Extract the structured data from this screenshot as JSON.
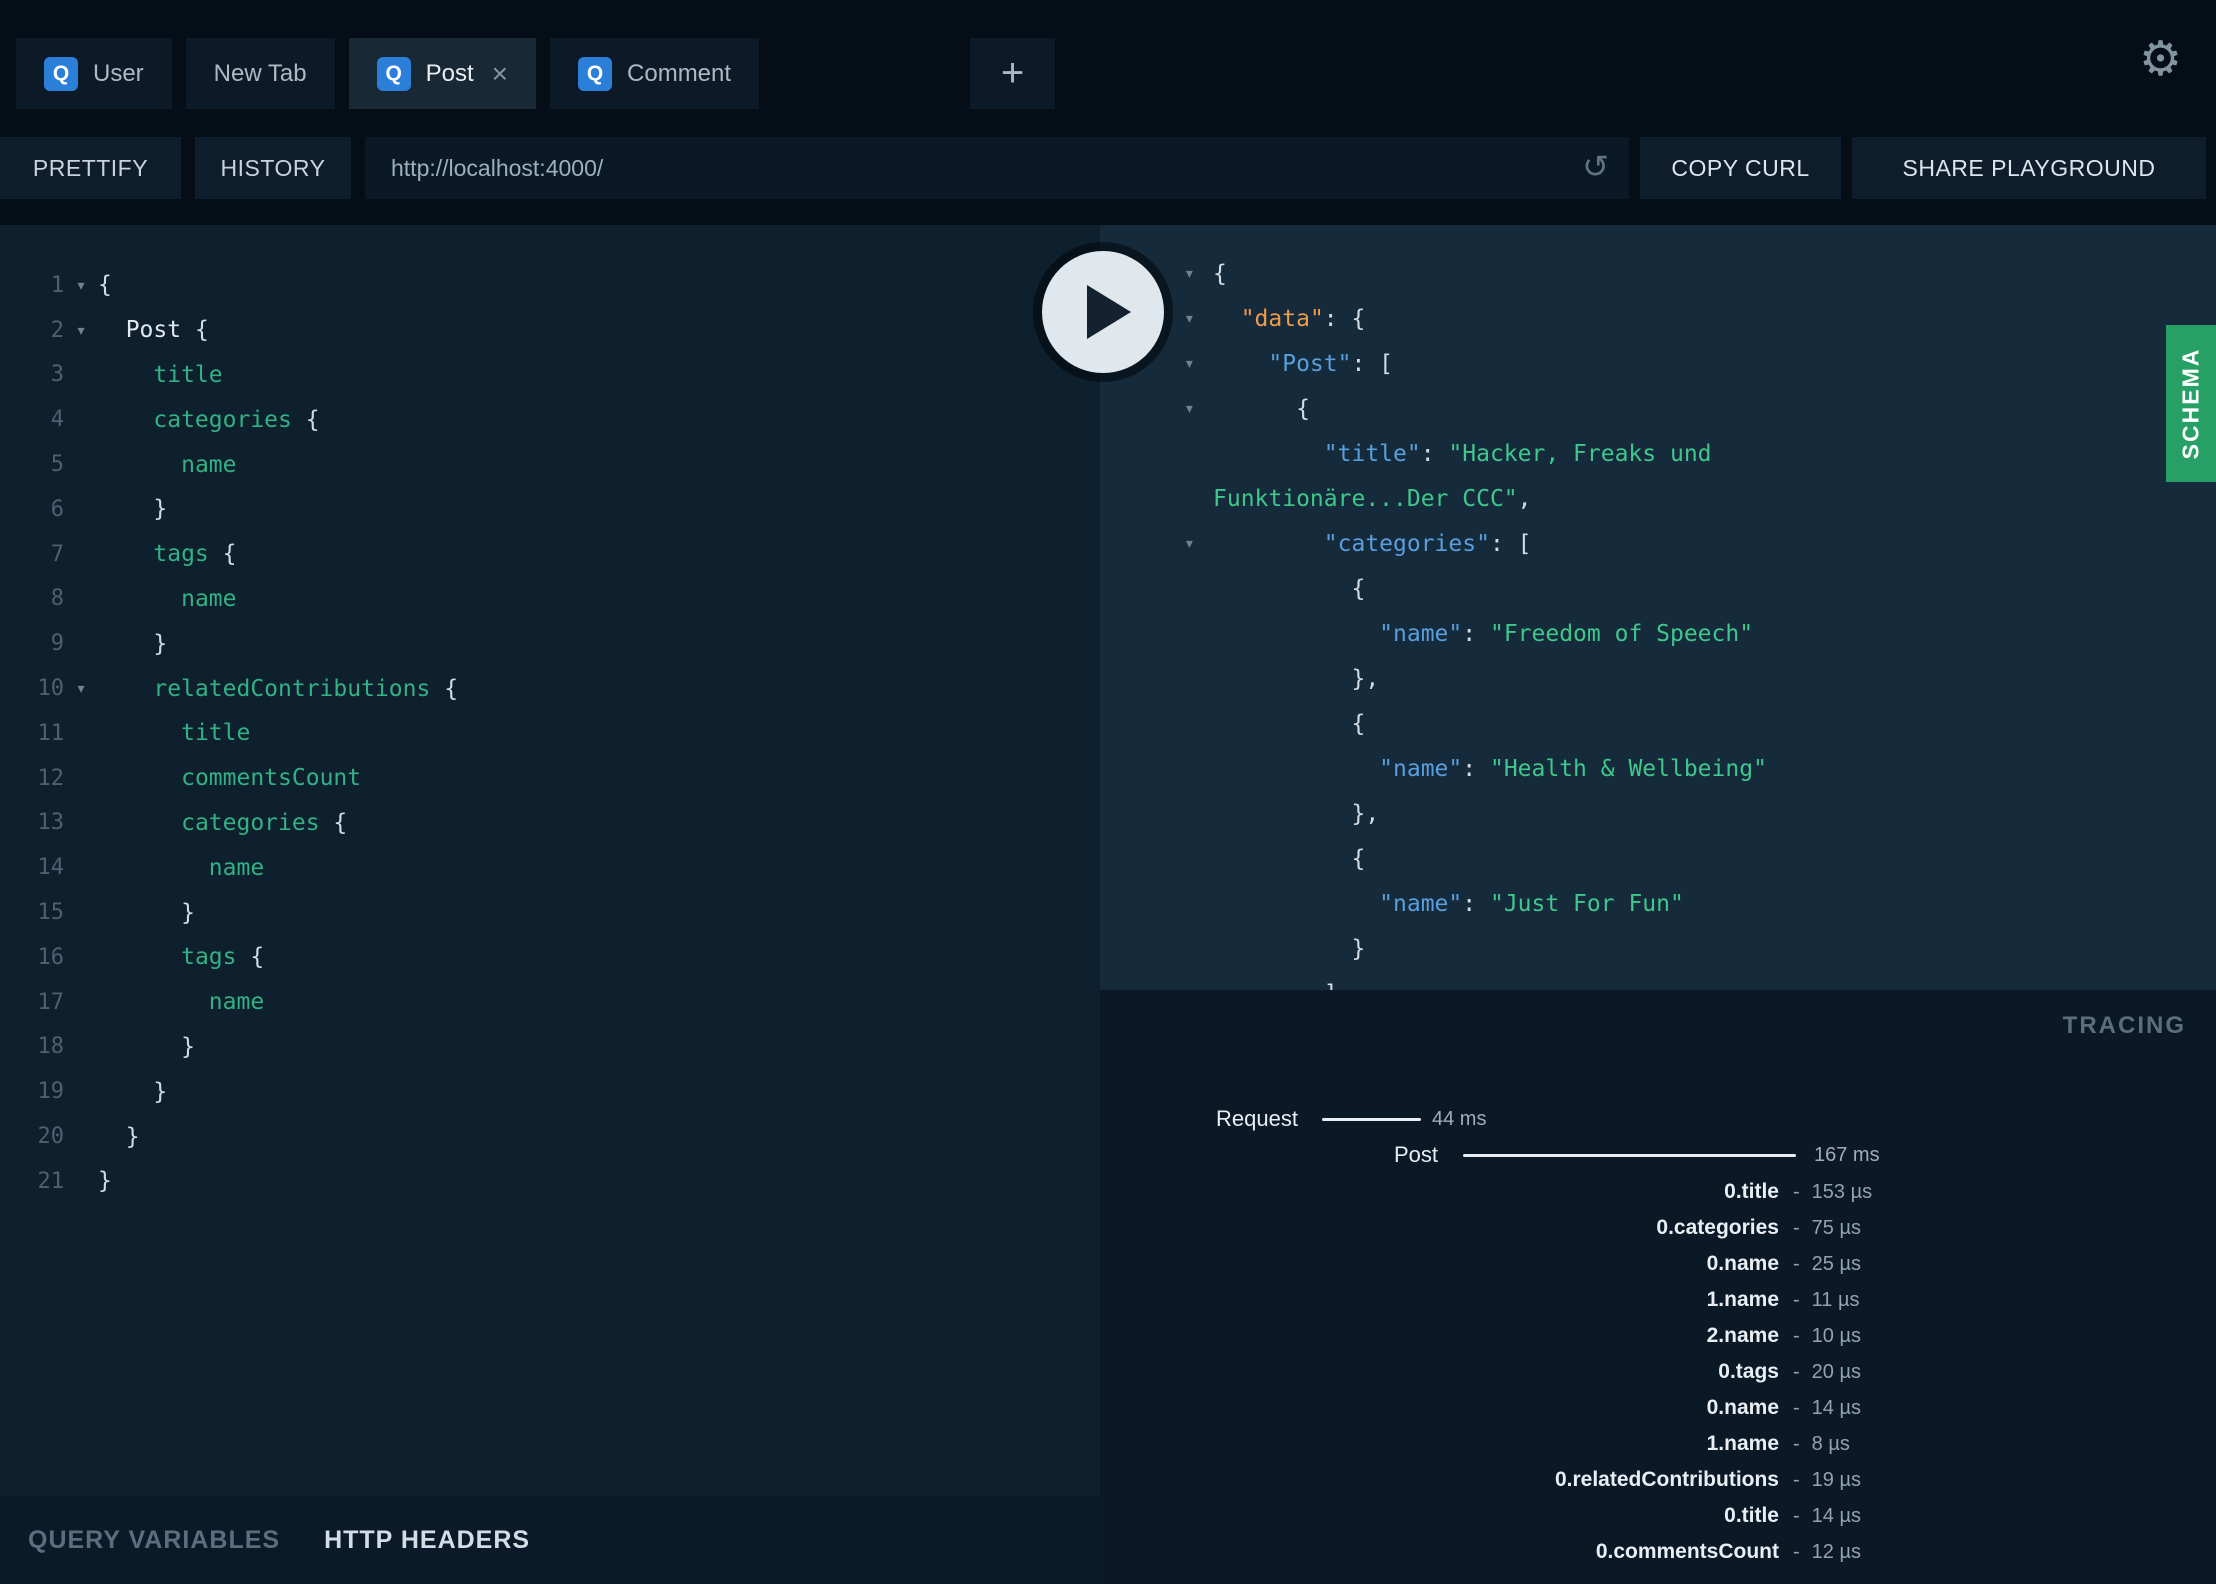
{
  "icons": {
    "gear": "⚙",
    "reload": "↺",
    "fold": "▾",
    "close": "×",
    "plus": "+"
  },
  "tabs": [
    {
      "label": "User",
      "icon": "Q",
      "active": false,
      "closable": false
    },
    {
      "label": "New Tab",
      "icon": null,
      "active": false,
      "closable": false
    },
    {
      "label": "Post",
      "icon": "Q",
      "active": true,
      "closable": true
    },
    {
      "label": "Comment",
      "icon": "Q",
      "active": false,
      "closable": false
    }
  ],
  "toolbar": {
    "prettify": "PRETTIFY",
    "history": "HISTORY",
    "url": "http://localhost:4000/",
    "copy_curl": "COPY CURL",
    "share_playground": "SHARE PLAYGROUND"
  },
  "query_editor": {
    "lines": [
      {
        "n": 1,
        "fold": true,
        "tokens": [
          {
            "t": "{",
            "c": "pn"
          }
        ]
      },
      {
        "n": 2,
        "fold": true,
        "tokens": [
          {
            "t": "  ",
            "c": "pn"
          },
          {
            "t": "Post",
            "c": "ty"
          },
          {
            "t": " {",
            "c": "pn"
          }
        ]
      },
      {
        "n": 3,
        "fold": false,
        "tokens": [
          {
            "t": "    ",
            "c": "pn"
          },
          {
            "t": "title",
            "c": "fd"
          }
        ]
      },
      {
        "n": 4,
        "fold": false,
        "tokens": [
          {
            "t": "    ",
            "c": "pn"
          },
          {
            "t": "categories",
            "c": "fd"
          },
          {
            "t": " {",
            "c": "pn"
          }
        ]
      },
      {
        "n": 5,
        "fold": false,
        "tokens": [
          {
            "t": "      ",
            "c": "pn"
          },
          {
            "t": "name",
            "c": "fd"
          }
        ]
      },
      {
        "n": 6,
        "fold": false,
        "tokens": [
          {
            "t": "    }",
            "c": "pn"
          }
        ]
      },
      {
        "n": 7,
        "fold": false,
        "tokens": [
          {
            "t": "    ",
            "c": "pn"
          },
          {
            "t": "tags",
            "c": "fd"
          },
          {
            "t": " {",
            "c": "pn"
          }
        ]
      },
      {
        "n": 8,
        "fold": false,
        "tokens": [
          {
            "t": "      ",
            "c": "pn"
          },
          {
            "t": "name",
            "c": "fd"
          }
        ]
      },
      {
        "n": 9,
        "fold": false,
        "tokens": [
          {
            "t": "    }",
            "c": "pn"
          }
        ]
      },
      {
        "n": 10,
        "fold": true,
        "tokens": [
          {
            "t": "    ",
            "c": "pn"
          },
          {
            "t": "relatedContributions",
            "c": "fd"
          },
          {
            "t": " {",
            "c": "pn"
          }
        ]
      },
      {
        "n": 11,
        "fold": false,
        "tokens": [
          {
            "t": "      ",
            "c": "pn"
          },
          {
            "t": "title",
            "c": "fd"
          }
        ]
      },
      {
        "n": 12,
        "fold": false,
        "tokens": [
          {
            "t": "      ",
            "c": "pn"
          },
          {
            "t": "commentsCount",
            "c": "fd"
          }
        ]
      },
      {
        "n": 13,
        "fold": false,
        "tokens": [
          {
            "t": "      ",
            "c": "pn"
          },
          {
            "t": "categories",
            "c": "fd"
          },
          {
            "t": " {",
            "c": "pn"
          }
        ]
      },
      {
        "n": 14,
        "fold": false,
        "tokens": [
          {
            "t": "        ",
            "c": "pn"
          },
          {
            "t": "name",
            "c": "fd"
          }
        ]
      },
      {
        "n": 15,
        "fold": false,
        "tokens": [
          {
            "t": "      }",
            "c": "pn"
          }
        ]
      },
      {
        "n": 16,
        "fold": false,
        "tokens": [
          {
            "t": "      ",
            "c": "pn"
          },
          {
            "t": "tags",
            "c": "fd"
          },
          {
            "t": " {",
            "c": "pn"
          }
        ]
      },
      {
        "n": 17,
        "fold": false,
        "tokens": [
          {
            "t": "        ",
            "c": "pn"
          },
          {
            "t": "name",
            "c": "fd"
          }
        ]
      },
      {
        "n": 18,
        "fold": false,
        "tokens": [
          {
            "t": "      }",
            "c": "pn"
          }
        ]
      },
      {
        "n": 19,
        "fold": false,
        "tokens": [
          {
            "t": "    }",
            "c": "pn"
          }
        ]
      },
      {
        "n": 20,
        "fold": false,
        "tokens": [
          {
            "t": "  }",
            "c": "pn"
          }
        ]
      },
      {
        "n": 21,
        "fold": false,
        "tokens": [
          {
            "t": "}",
            "c": "pn"
          }
        ]
      }
    ]
  },
  "response_viewer": {
    "lines": [
      {
        "fold": true,
        "tokens": [
          {
            "t": "{",
            "c": "pn"
          }
        ]
      },
      {
        "fold": true,
        "tokens": [
          {
            "t": "  ",
            "c": "pn"
          },
          {
            "t": "\"data\"",
            "c": "kr"
          },
          {
            "t": ": {",
            "c": "pn"
          }
        ]
      },
      {
        "fold": true,
        "tokens": [
          {
            "t": "    ",
            "c": "pn"
          },
          {
            "t": "\"Post\"",
            "c": "ky"
          },
          {
            "t": ": [",
            "c": "pn"
          }
        ]
      },
      {
        "fold": true,
        "tokens": [
          {
            "t": "      {",
            "c": "pn"
          }
        ]
      },
      {
        "fold": false,
        "tokens": [
          {
            "t": "        ",
            "c": "pn"
          },
          {
            "t": "\"title\"",
            "c": "ky"
          },
          {
            "t": ": ",
            "c": "pn"
          },
          {
            "t": "\"Hacker, Freaks und",
            "c": "st"
          }
        ]
      },
      {
        "fold": false,
        "tokens": [
          {
            "t": "Funktionäre...Der CCC\"",
            "c": "st"
          },
          {
            "t": ",",
            "c": "pn"
          }
        ]
      },
      {
        "fold": true,
        "tokens": [
          {
            "t": "        ",
            "c": "pn"
          },
          {
            "t": "\"categories\"",
            "c": "ky"
          },
          {
            "t": ": [",
            "c": "pn"
          }
        ]
      },
      {
        "fold": false,
        "tokens": [
          {
            "t": "          {",
            "c": "pn"
          }
        ]
      },
      {
        "fold": false,
        "tokens": [
          {
            "t": "            ",
            "c": "pn"
          },
          {
            "t": "\"name\"",
            "c": "ky"
          },
          {
            "t": ": ",
            "c": "pn"
          },
          {
            "t": "\"Freedom of Speech\"",
            "c": "st"
          }
        ]
      },
      {
        "fold": false,
        "tokens": [
          {
            "t": "          },",
            "c": "pn"
          }
        ]
      },
      {
        "fold": false,
        "tokens": [
          {
            "t": "          {",
            "c": "pn"
          }
        ]
      },
      {
        "fold": false,
        "tokens": [
          {
            "t": "            ",
            "c": "pn"
          },
          {
            "t": "\"name\"",
            "c": "ky"
          },
          {
            "t": ": ",
            "c": "pn"
          },
          {
            "t": "\"Health & Wellbeing\"",
            "c": "st"
          }
        ]
      },
      {
        "fold": false,
        "tokens": [
          {
            "t": "          },",
            "c": "pn"
          }
        ]
      },
      {
        "fold": false,
        "tokens": [
          {
            "t": "          {",
            "c": "pn"
          }
        ]
      },
      {
        "fold": false,
        "tokens": [
          {
            "t": "            ",
            "c": "pn"
          },
          {
            "t": "\"name\"",
            "c": "ky"
          },
          {
            "t": ": ",
            "c": "pn"
          },
          {
            "t": "\"Just For Fun\"",
            "c": "st"
          }
        ]
      },
      {
        "fold": false,
        "tokens": [
          {
            "t": "          }",
            "c": "pn"
          }
        ]
      },
      {
        "fold": false,
        "tokens": [
          {
            "t": "        ]",
            "c": "pn"
          }
        ]
      }
    ]
  },
  "schema": {
    "label": "SCHEMA"
  },
  "tracing": {
    "title": "TRACING",
    "spans": [
      {
        "label": "Request",
        "duration": "44 ms"
      },
      {
        "label": "Post",
        "duration": "167 ms"
      }
    ],
    "fields": [
      {
        "label": "0.title",
        "value": "153 µs"
      },
      {
        "label": "0.categories",
        "value": "75 µs"
      },
      {
        "label": "0.name",
        "value": "25 µs"
      },
      {
        "label": "1.name",
        "value": "11 µs"
      },
      {
        "label": "2.name",
        "value": "10 µs"
      },
      {
        "label": "0.tags",
        "value": "20 µs"
      },
      {
        "label": "0.name",
        "value": "14 µs"
      },
      {
        "label": "1.name",
        "value": "8 µs"
      },
      {
        "label": "0.relatedContributions",
        "value": "19 µs"
      },
      {
        "label": "0.title",
        "value": "14 µs"
      },
      {
        "label": "0.commentsCount",
        "value": "12 µs"
      }
    ]
  },
  "footer": {
    "query_variables": "QUERY VARIABLES",
    "http_headers": "HTTP HEADERS"
  }
}
